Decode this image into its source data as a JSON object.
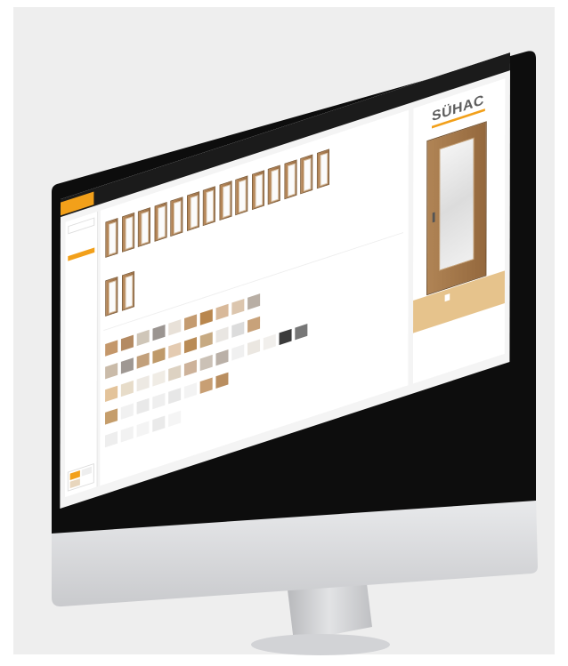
{
  "screen": {
    "tab_active": "",
    "user_area": "",
    "sidebar": {
      "header": "",
      "items": [
        "",
        "",
        "",
        "",
        "",
        "",
        "",
        ""
      ]
    },
    "doors": {
      "title": "",
      "items": [
        {
          "label": ""
        },
        {
          "label": ""
        },
        {
          "label": ""
        },
        {
          "label": ""
        },
        {
          "label": ""
        },
        {
          "label": ""
        },
        {
          "label": ""
        },
        {
          "label": ""
        },
        {
          "label": ""
        },
        {
          "label": ""
        },
        {
          "label": ""
        },
        {
          "label": ""
        },
        {
          "label": ""
        },
        {
          "label": ""
        },
        {
          "label": ""
        },
        {
          "label": ""
        }
      ]
    },
    "materials": {
      "title": "",
      "swatches": [
        {
          "color": "#c4976a"
        },
        {
          "color": "#b48a62"
        },
        {
          "color": "#cfc6b8"
        },
        {
          "color": "#9b9591"
        },
        {
          "color": "#e8e1d8"
        },
        {
          "color": "#c49b70"
        },
        {
          "color": "#b9874e"
        },
        {
          "color": "#d8b99a"
        },
        {
          "color": "#dcc6ae"
        },
        {
          "color": "#b8aea4"
        },
        {
          "color": "#cabba9"
        },
        {
          "color": "#9f9893"
        },
        {
          "color": "#c2a07b"
        },
        {
          "color": "#bf9a6a"
        },
        {
          "color": "#e4cbb1"
        },
        {
          "color": "#b98b56"
        },
        {
          "color": "#c7aa82"
        },
        {
          "color": "#e9e6e2"
        },
        {
          "color": "#dcdcdc"
        },
        {
          "color": "#c8a27a"
        },
        {
          "color": "#e3c39a"
        },
        {
          "color": "#e7dcc9"
        },
        {
          "color": "#ede9e3"
        },
        {
          "color": "#f0ece5"
        },
        {
          "color": "#ddd2c2"
        },
        {
          "color": "#cdb29a"
        },
        {
          "color": "#cbc1b6"
        },
        {
          "color": "#bab0a7"
        },
        {
          "color": "#f0f0f0"
        },
        {
          "color": "#ebe7e1"
        },
        {
          "color": "#f1efec"
        },
        {
          "color": "#3b3b3b"
        },
        {
          "color": "#777777"
        },
        {
          "color": "#c59d6b"
        },
        {
          "color": "#f1f1f1"
        },
        {
          "color": "#e9e9e9"
        },
        {
          "color": "#efefef"
        },
        {
          "color": "#e7e7e7"
        },
        {
          "color": "#f3f3f3"
        },
        {
          "color": "#c89f74"
        },
        {
          "color": "#b98e60"
        },
        {
          "color": "#eeeeee"
        },
        {
          "color": "#f2f2f2"
        },
        {
          "color": "#f4f4f4"
        },
        {
          "color": "#eaeaea"
        },
        {
          "color": "#f5f5f5"
        }
      ]
    },
    "preview": {
      "logo": "SÜHAC"
    },
    "footer_links": [
      "",
      "",
      "",
      "",
      "",
      ""
    ],
    "colors": {
      "accent": "#f2a01a",
      "dark_bar": "#1b1b1b",
      "bezel": "#0d0d0d",
      "chin": "#dcdde0",
      "stand": "#c9cacd"
    }
  }
}
